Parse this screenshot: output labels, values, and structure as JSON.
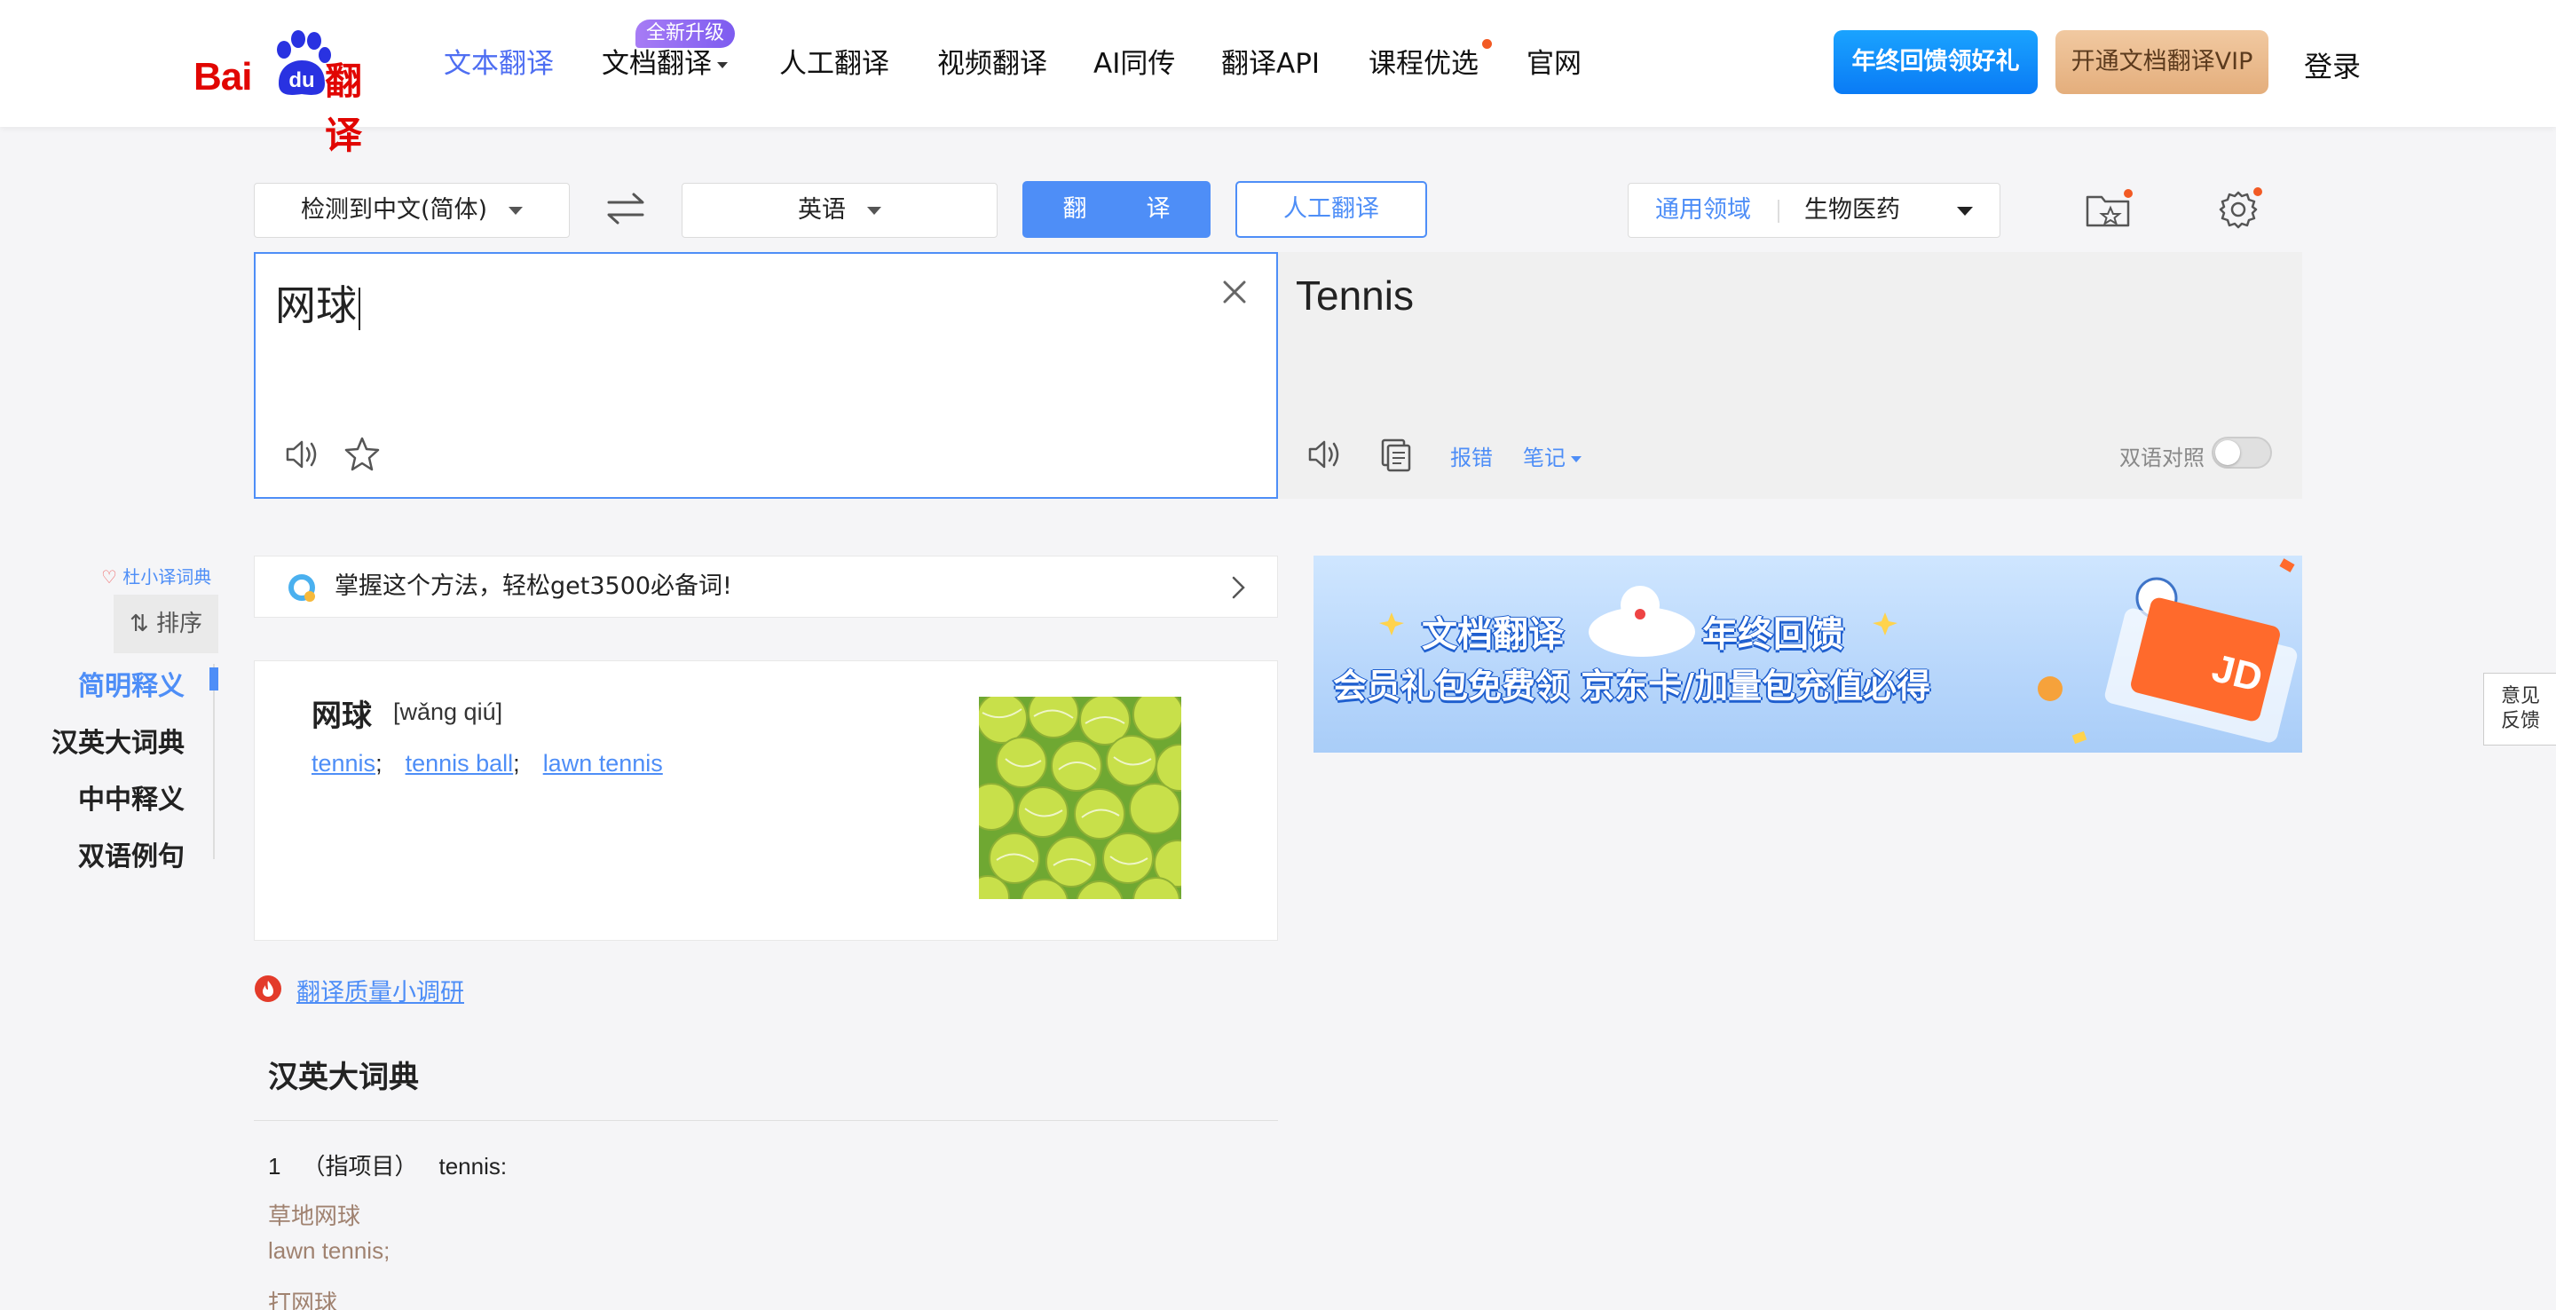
{
  "header": {
    "logo": {
      "bai": "Bai",
      "du": "du",
      "fanyi": "翻译"
    },
    "nav": [
      {
        "label": "文本翻译",
        "active": true
      },
      {
        "label": "文档翻译",
        "badge": "全新升级",
        "dropdown": true
      },
      {
        "label": "人工翻译"
      },
      {
        "label": "视频翻译"
      },
      {
        "label": "AI同传"
      },
      {
        "label": "翻译API"
      },
      {
        "label": "课程优选",
        "dot": true
      },
      {
        "label": "官网"
      }
    ],
    "gift_button": "年终回馈领好礼",
    "vip_button": "开通文档翻译VIP",
    "login": "登录"
  },
  "toolbar": {
    "source_lang": "检测到中文(简体)",
    "target_lang": "英语",
    "translate_button": "翻　译",
    "human_button": "人工翻译",
    "domain_label": "通用领域",
    "domain_value": "生物医药"
  },
  "source": {
    "text": "网球"
  },
  "target": {
    "text": "Tennis",
    "report": "报错",
    "notes": "笔记",
    "bilingual": "双语对照"
  },
  "left_nav": {
    "dict_label": "杜小译词典",
    "sort_label": "排序",
    "items": [
      {
        "label": "简明释义",
        "active": true
      },
      {
        "label": "汉英大词典"
      },
      {
        "label": "中中释义"
      },
      {
        "label": "双语例句"
      }
    ]
  },
  "tip": {
    "text": "掌握这个方法，轻松get3500必备词!"
  },
  "dict_card": {
    "word": "网球",
    "pron": "[wǎng qiú]",
    "defs": [
      "tennis",
      "tennis ball",
      "lawn tennis"
    ]
  },
  "banner": {
    "line1a": "文档翻译",
    "line1b": "年终回馈",
    "line2": "会员礼包免费领  京东卡/加量包充值必得"
  },
  "survey": {
    "label": "翻译质量小调研"
  },
  "big_dict": {
    "title": "汉英大词典",
    "entry": {
      "num": "1",
      "tag": "（指项目）",
      "def": "tennis:"
    },
    "examples": [
      {
        "cn": "草地网球",
        "en": "lawn tennis;"
      },
      {
        "cn": "打网球",
        "en": ""
      }
    ]
  },
  "feedback": {
    "line1": "意见",
    "line2": "反馈"
  },
  "colors": {
    "accent": "#4e8ef7",
    "brand_red": "#e10602",
    "nav_active": "#4e6ef2"
  }
}
